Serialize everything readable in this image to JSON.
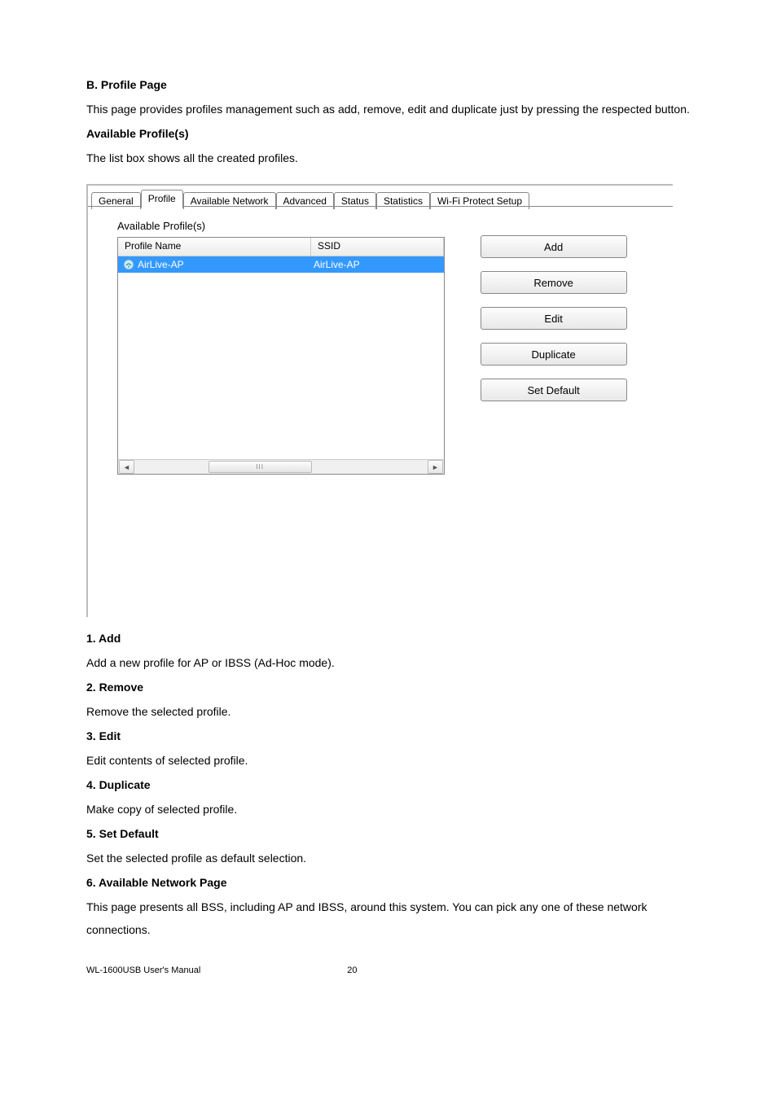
{
  "doc": {
    "h_b": "B. Profile Page",
    "p_b1": "This page provides profiles management such as add, remove, edit and duplicate just by pressing the respected button.",
    "h_avail": "Available Profile(s)",
    "p_avail": "The list box shows all the created profiles.",
    "h1": "1. Add",
    "p1": "Add a new profile for AP or IBSS (Ad-Hoc mode).",
    "h2": "2. Remove",
    "p2": "Remove the selected profile.",
    "h3": "3. Edit",
    "p3": "Edit contents of selected profile.",
    "h4": "4. Duplicate",
    "p4": "Make copy of selected profile.",
    "h5": "5. Set Default",
    "p5": "Set the selected profile as default selection.",
    "h6": "6. Available Network Page",
    "p6": "This page presents all BSS, including AP and IBSS, around this system. You can pick any one of these network connections."
  },
  "ui": {
    "tabs": {
      "general": "General",
      "profile": "Profile",
      "available_network": "Available Network",
      "advanced": "Advanced",
      "status": "Status",
      "statistics": "Statistics",
      "wps": "Wi-Fi Protect Setup"
    },
    "section_label": "Available Profile(s)",
    "columns": {
      "name": "Profile Name",
      "ssid": "SSID"
    },
    "rows": [
      {
        "name": "AirLive-AP",
        "ssid": "AirLive-AP"
      }
    ],
    "buttons": {
      "add": "Add",
      "remove": "Remove",
      "edit": "Edit",
      "duplicate": "Duplicate",
      "set_default": "Set Default"
    }
  },
  "footer": {
    "manual": "WL-1600USB User's Manual",
    "page": "20"
  }
}
